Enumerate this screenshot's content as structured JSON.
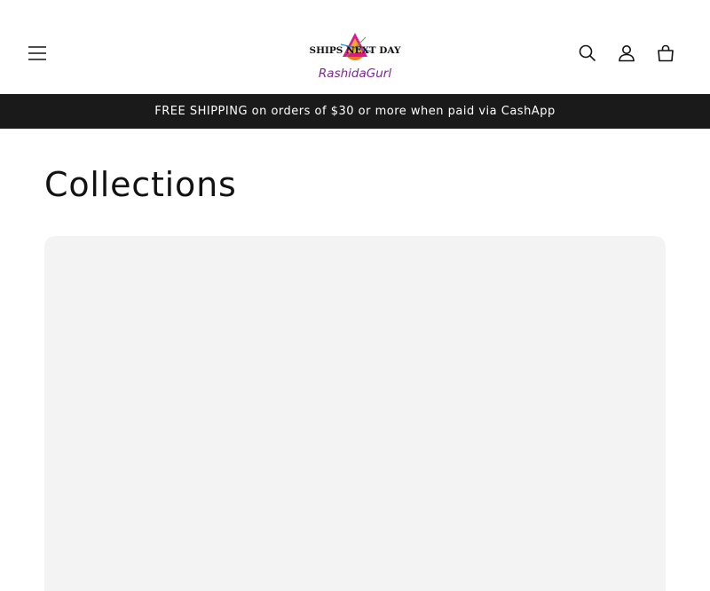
{
  "header": {
    "logo": {
      "line1": "SHIPS NEXT DAY",
      "line2": "RashidaGurl"
    },
    "icons": {
      "menu": "hamburger-menu-icon",
      "search": "search-icon",
      "account": "account-icon",
      "cart": "cart-icon"
    }
  },
  "announcement": {
    "text": "FREE SHIPPING on orders of $30 or more when paid via CashApp"
  },
  "main": {
    "title": "Collections"
  },
  "colors": {
    "announcement_bg": "#1a1a1a",
    "card_bg": "#f3f3f3",
    "logo_pink": "#d91a8c",
    "logo_purple": "#7a2a8c"
  }
}
